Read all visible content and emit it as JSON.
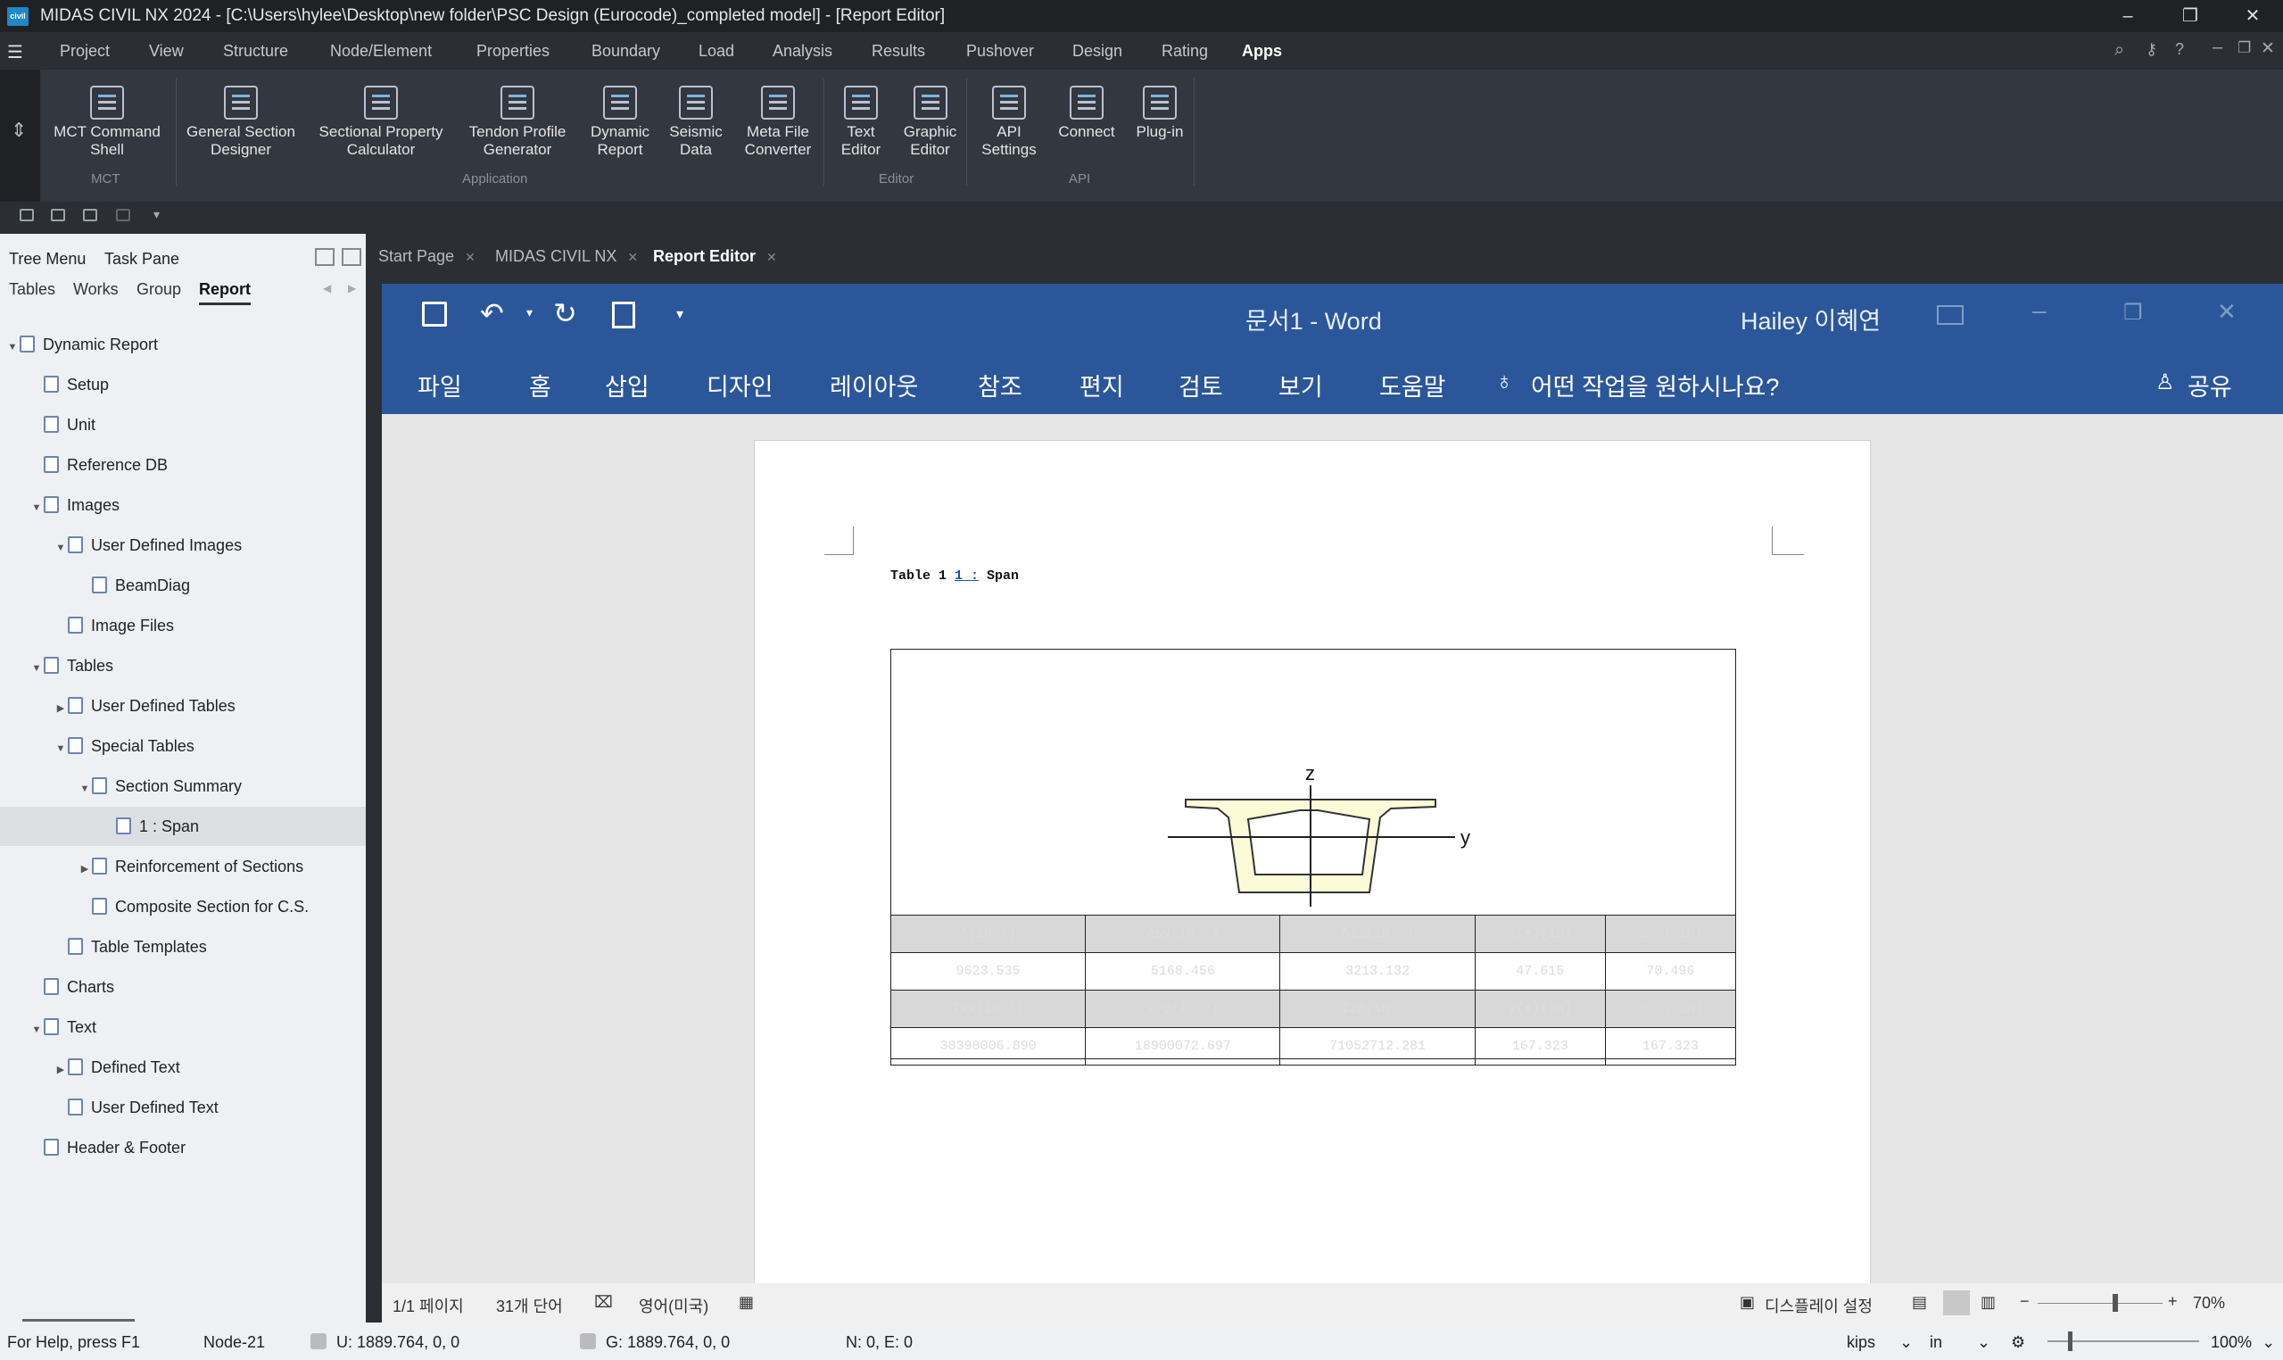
{
  "window": {
    "app_badge": "civil",
    "title": "MIDAS CIVIL NX 2024 - [C:\\Users\\hylee\\Desktop\\new folder\\PSC Design (Eurocode)_completed model] - [Report Editor]",
    "controls": [
      "–",
      "❐",
      "✕"
    ]
  },
  "menu": {
    "items": [
      "Project",
      "View",
      "Structure",
      "Node/Element",
      "Properties",
      "Boundary",
      "Load",
      "Analysis",
      "Results",
      "Pushover",
      "Design",
      "Rating",
      "Apps"
    ],
    "active": "Apps"
  },
  "ribbon": {
    "buttons": [
      {
        "label": "MCT Command Shell",
        "icon": "mct-command-shell-icon"
      },
      {
        "label": "General Section Designer",
        "icon": "general-section-designer-icon"
      },
      {
        "label": "Sectional Property Calculator",
        "icon": "sectional-property-calculator-icon"
      },
      {
        "label": "Tendon Profile Generator",
        "icon": "tendon-profile-icon"
      },
      {
        "label": "Dynamic Report",
        "icon": "dynamic-report-icon"
      },
      {
        "label": "Seismic Data",
        "icon": "seismic-data-icon"
      },
      {
        "label": "Meta File Converter",
        "icon": "dxf-converter-icon"
      },
      {
        "label": "Text Editor",
        "icon": "text-editor-icon"
      },
      {
        "label": "Graphic Editor",
        "icon": "graphic-editor-icon"
      },
      {
        "label": "API Settings",
        "icon": "api-settings-icon"
      },
      {
        "label": "Connect",
        "icon": "connect-icon"
      },
      {
        "label": "Plug-in",
        "icon": "plugin-icon"
      }
    ],
    "groups": [
      "MCT",
      "Application",
      "Editor",
      "API"
    ]
  },
  "left_panel": {
    "header": [
      "Tree Menu",
      "Task Pane"
    ],
    "tabs": [
      "Tables",
      "Works",
      "Group",
      "Report"
    ],
    "active_tab": "Report",
    "tree": [
      {
        "label": "Dynamic Report",
        "level": 0,
        "arrow": "▼"
      },
      {
        "label": "Setup",
        "level": 1,
        "arrow": ""
      },
      {
        "label": "Unit",
        "level": 1,
        "arrow": ""
      },
      {
        "label": "Reference DB",
        "level": 1,
        "arrow": ""
      },
      {
        "label": "Images",
        "level": 1,
        "arrow": "▼"
      },
      {
        "label": "User Defined Images",
        "level": 2,
        "arrow": "▼"
      },
      {
        "label": "BeamDiag",
        "level": 3,
        "arrow": ""
      },
      {
        "label": "Image Files",
        "level": 2,
        "arrow": ""
      },
      {
        "label": "Tables",
        "level": 1,
        "arrow": "▼"
      },
      {
        "label": "User Defined Tables",
        "level": 2,
        "arrow": "▶"
      },
      {
        "label": "Special Tables",
        "level": 2,
        "arrow": "▼"
      },
      {
        "label": "Section Summary",
        "level": 3,
        "arrow": "▼"
      },
      {
        "label": "1 : Span",
        "level": 4,
        "arrow": "",
        "selected": true
      },
      {
        "label": "Reinforcement of Sections",
        "level": 3,
        "arrow": "▶"
      },
      {
        "label": "Composite Section for C.S.",
        "level": 3,
        "arrow": ""
      },
      {
        "label": "Table Templates",
        "level": 2,
        "arrow": ""
      },
      {
        "label": "Charts",
        "level": 1,
        "arrow": ""
      },
      {
        "label": "Text",
        "level": 1,
        "arrow": "▼"
      },
      {
        "label": "Defined Text",
        "level": 2,
        "arrow": "▶"
      },
      {
        "label": "User Defined Text",
        "level": 2,
        "arrow": ""
      },
      {
        "label": "Header & Footer",
        "level": 1,
        "arrow": ""
      }
    ]
  },
  "doc_tabs": [
    {
      "label": "Start Page",
      "selected": false
    },
    {
      "label": "MIDAS CIVIL NX",
      "selected": false
    },
    {
      "label": "Report Editor",
      "selected": true
    }
  ],
  "word": {
    "doc_title": "문서1  -  Word",
    "user": "Hailey 이혜연",
    "ribbon_tabs": [
      "파일",
      "홈",
      "삽입",
      "디자인",
      "레이아웃",
      "참조",
      "편지",
      "검토",
      "보기",
      "도움말"
    ],
    "tell_me": "어떤 작업을 원하시나요?",
    "share": "공유",
    "status": {
      "page": "1/1 페이지",
      "words": "31개 단어",
      "language": "영어(미국)",
      "display_settings": "디스플레이 설정",
      "zoom": "70%"
    }
  },
  "document": {
    "caption_prefix": "Table 1 ",
    "caption_link": "1 :",
    "caption_suffix": " Span",
    "axis_z": "z",
    "axis_y": "y",
    "table": {
      "row1_headers": [
        "A(in ²)",
        "Asy(in ²)",
        "Asz(in ²)",
        "z(+)(in)",
        "z(-)(in)"
      ],
      "row1_values": [
        "9623.535",
        "5168.456",
        "3213.132",
        "47.615",
        "70.496"
      ],
      "row2_headers": [
        "Ixx(in ⁴)",
        "Iyy(in ⁴)",
        "Izz(in ⁴)",
        "y(+)(in)",
        "y(-)(in)"
      ],
      "row2_values": [
        "38398006.890",
        "18900072.697",
        "71052712.281",
        "167.323",
        "167.323"
      ]
    }
  },
  "statusbar": {
    "help": "For Help, press F1",
    "node": "Node-21",
    "u": "U: 1889.764, 0, 0",
    "g": "G: 1889.764, 0, 0",
    "ne": "N: 0, E: 0",
    "force_unit": "kips",
    "length_unit": "in",
    "zoom": "100%"
  },
  "colors": {
    "word_blue": "#2b579a",
    "app_dark": "#2b2e33",
    "section_fill": "#fafad2"
  }
}
